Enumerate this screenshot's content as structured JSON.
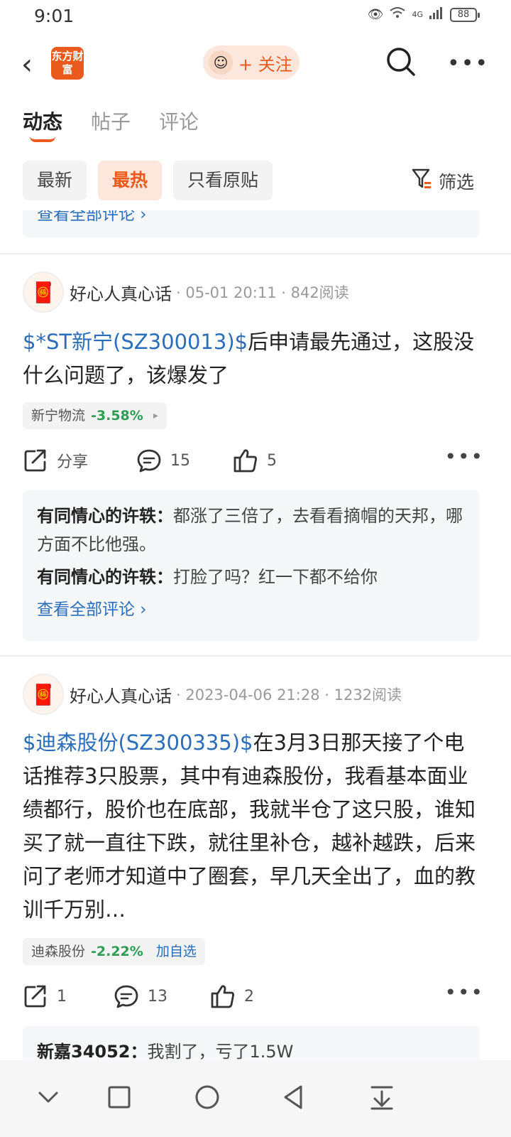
{
  "status": {
    "time": "9:01",
    "network": "4G",
    "battery": "88"
  },
  "header": {
    "logo_text": "东方财富",
    "follow_label": "+ 关注"
  },
  "tabs": [
    {
      "label": "动态"
    },
    {
      "label": "帖子"
    },
    {
      "label": "评论"
    }
  ],
  "filters": {
    "chips": [
      {
        "label": "最新"
      },
      {
        "label": "最热"
      },
      {
        "label": "只看原贴"
      }
    ],
    "filter_label": "筛选"
  },
  "top_partial": {
    "view_all": "查看全部评论 ›"
  },
  "posts": [
    {
      "author": "好心人真心话",
      "meta": "· 05-01 20:11 · 842阅读",
      "stock_link": "$*ST新宁(SZ300013)$",
      "text": "后申请最先通过，这股没什么问题了，该爆发了",
      "tag_name": "新宁物流",
      "tag_change": "-3.58%",
      "tag_arrow": "▸",
      "share": "分享",
      "comments": "15",
      "likes": "5",
      "replies": [
        {
          "user": "有同情心的许轶",
          "text": "都涨了三倍了，去看看摘帽的天邦，哪方面不比他强。"
        },
        {
          "user": "有同情心的许轶",
          "text": "打脸了吗？红一下都不给你"
        }
      ],
      "view_all": "查看全部评论 ›"
    },
    {
      "author": "好心人真心话",
      "meta": "· 2023-04-06 21:28 · 1232阅读",
      "stock_link": "$迪森股份(SZ300335)$",
      "text": "在3月3日那天接了个电话推荐3只股票，其中有迪森股份，我看基本面业绩都行，股价也在底部，我就半仓了这只股，谁知买了就一直往下跌，就往里补仓，越补越跌，后来问了老师才知道中了圈套，早几天全出了，血的教训千万别…",
      "tag_name": "迪森股份",
      "tag_change": "-2.22%",
      "tag_add": "加自选",
      "share": "1",
      "comments": "13",
      "likes": "2",
      "replies": [
        {
          "user": "新嘉34052",
          "text": "我割了，亏了1.5W"
        }
      ]
    }
  ],
  "colors": {
    "accent": "#ea5a1c",
    "link": "#2a6ebb",
    "down": "#2e9d54"
  }
}
